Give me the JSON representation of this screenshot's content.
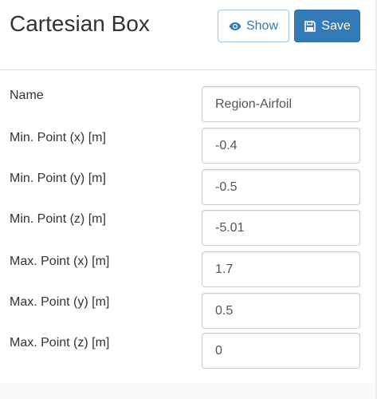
{
  "panel": {
    "title": "Cartesian Box",
    "buttons": {
      "show_label": "Show",
      "save_label": "Save"
    }
  },
  "fields": [
    {
      "label": "Name",
      "value": "Region-Airfoil"
    },
    {
      "label": "Min. Point (x) [m]",
      "value": "-0.4"
    },
    {
      "label": "Min. Point (y) [m]",
      "value": "-0.5"
    },
    {
      "label": "Min. Point (z) [m]",
      "value": "-5.01"
    },
    {
      "label": "Max. Point (x) [m]",
      "value": "1.7"
    },
    {
      "label": "Max. Point (y) [m]",
      "value": "0.5"
    },
    {
      "label": "Max. Point (z) [m]",
      "value": "0"
    }
  ],
  "icons": {
    "show": "eye-icon",
    "save": "floppy-disk-icon"
  },
  "colors": {
    "primary": "#337ab7",
    "primary_border": "#2e6da4",
    "show_border": "#9fc6e4",
    "text": "#333333",
    "input_text": "#555555"
  }
}
